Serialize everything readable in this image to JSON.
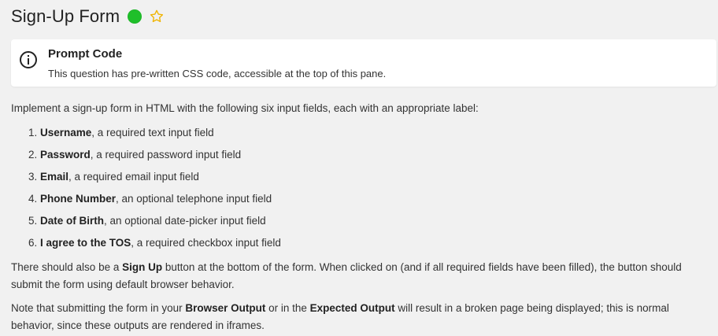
{
  "header": {
    "title": "Sign-Up Form",
    "status_color": "#1fbf2a",
    "star_icon": "star-outline-icon"
  },
  "prompt_card": {
    "title": "Prompt Code",
    "text": "This question has pre-written CSS code, accessible at the top of this pane.",
    "icon": "info-icon"
  },
  "body": {
    "intro": "Implement a sign-up form in HTML with the following six input fields, each with an appropriate label:",
    "fields": [
      {
        "name": "Username",
        "desc": ", a required text input field"
      },
      {
        "name": "Password",
        "desc": ", a required password input field"
      },
      {
        "name": "Email",
        "desc": ", a required email input field"
      },
      {
        "name": "Phone Number",
        "desc": ", an optional telephone input field"
      },
      {
        "name": "Date of Birth",
        "desc": ", an optional date-picker input field"
      },
      {
        "name": "I agree to the TOS",
        "desc": ", a required checkbox input field"
      }
    ],
    "para2_a": "There should also be a ",
    "para2_b": "Sign Up",
    "para2_c": " button at the bottom of the form. When clicked on (and if all required fields have been filled), the button should submit the form using default browser behavior.",
    "para3_a": "Note that submitting the form in your ",
    "para3_b": "Browser Output",
    "para3_c": " or in the ",
    "para3_d": "Expected Output",
    "para3_e": " will result in a broken page being displayed; this is normal behavior, since these outputs are rendered in iframes."
  }
}
